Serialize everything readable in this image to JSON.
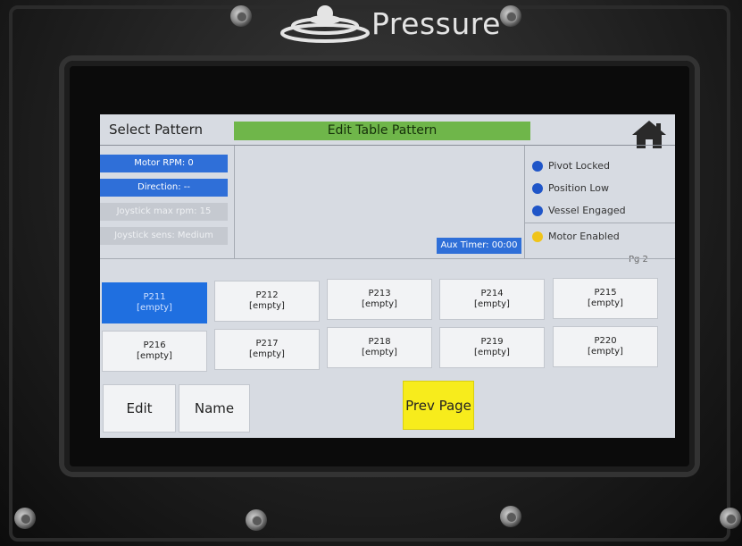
{
  "brand": {
    "name": "Pressure"
  },
  "header": {
    "select_label": "Select Pattern",
    "title": "Edit Table Pattern"
  },
  "status": {
    "motor_rpm": "Motor RPM: 0",
    "direction": "Direction: --",
    "joystick_max": "Joystick max rpm: 15",
    "joystick_sens": "Joystick sens: Medium",
    "aux_timer": "Aux Timer: 00:00"
  },
  "indicators": [
    {
      "label": "Pivot Locked",
      "color": "#1f55c8"
    },
    {
      "label": "Position Low",
      "color": "#1f55c8"
    },
    {
      "label": "Vessel Engaged",
      "color": "#1f55c8"
    },
    {
      "label": "Motor Enabled",
      "color": "#f0c419"
    }
  ],
  "page_label": "Pg 2",
  "patterns": [
    {
      "name": "P211",
      "state": "[empty]",
      "selected": true
    },
    {
      "name": "P212",
      "state": "[empty]"
    },
    {
      "name": "P213",
      "state": "[empty]"
    },
    {
      "name": "P214",
      "state": "[empty]"
    },
    {
      "name": "P215",
      "state": "[empty]"
    },
    {
      "name": "P216",
      "state": "[empty]"
    },
    {
      "name": "P217",
      "state": "[empty]"
    },
    {
      "name": "P218",
      "state": "[empty]"
    },
    {
      "name": "P219",
      "state": "[empty]"
    },
    {
      "name": "P220",
      "state": "[empty]"
    }
  ],
  "actions": {
    "edit": "Edit",
    "name": "Name",
    "prev_page": "Prev Page"
  },
  "colors": {
    "accent_blue": "#1f6fe0",
    "title_green": "#6fb64a",
    "prev_yellow": "#f7ec1c"
  }
}
